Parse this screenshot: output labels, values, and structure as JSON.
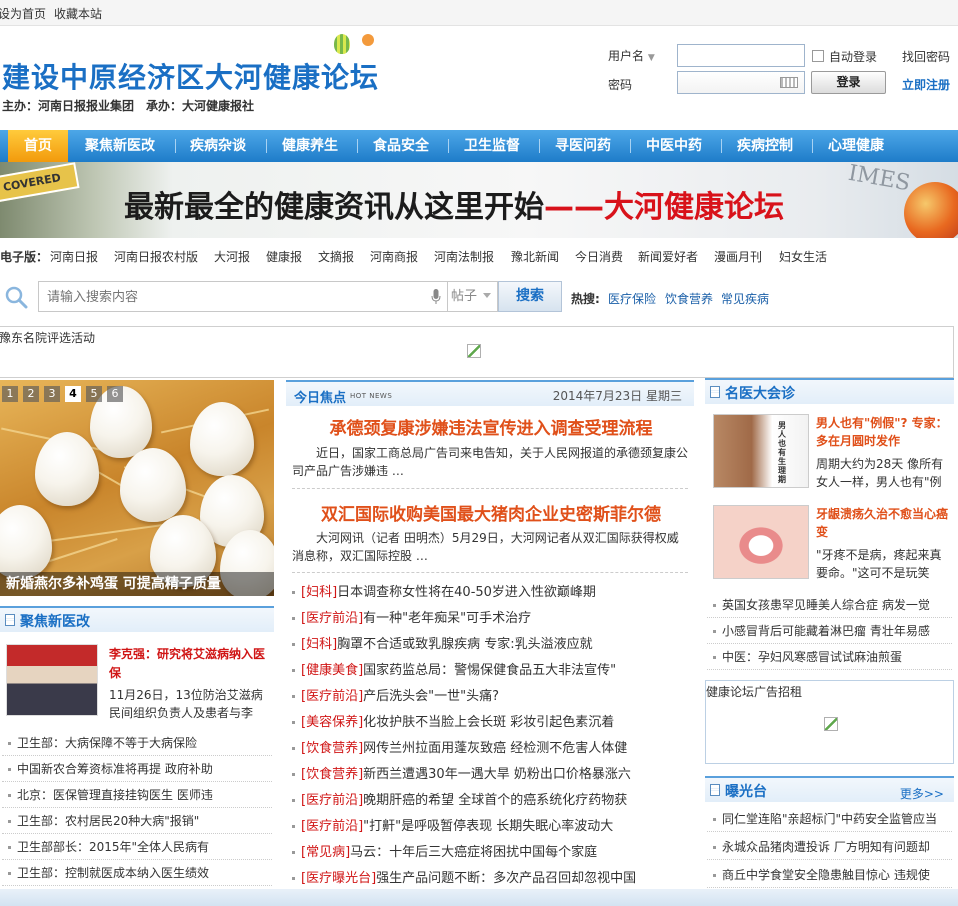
{
  "topbar": {
    "set_home": "设为首页",
    "bookmark": "收藏本站"
  },
  "header": {
    "site_title": "建设中原经济区大河健康论坛",
    "sponsor": "主办：河南日报报业集团　承办：大河健康报社"
  },
  "login": {
    "username_label": "用户名",
    "password_label": "密码",
    "auto_login": "自动登录",
    "forgot": "找回密码",
    "login_button": "登录",
    "register": "立即注册"
  },
  "nav": {
    "items": [
      "首页",
      "聚焦新医改",
      "疾病杂谈",
      "健康养生",
      "食品安全",
      "卫生监督",
      "寻医问药",
      "中医中药",
      "疾病控制",
      "心理健康"
    ]
  },
  "banner": {
    "text_black": "最新最全的健康资讯从这里开始",
    "text_red": "——大河健康论坛",
    "sign": "COVERED",
    "times": "IMES"
  },
  "editions": {
    "label": "电子版：",
    "items": [
      "河南日报",
      "河南日报农村版",
      "大河报",
      "健康报",
      "文摘报",
      "河南商报",
      "河南法制报",
      "豫北新闻",
      "今日消费",
      "新闻爱好者",
      "漫画月刊",
      "妇女生活"
    ]
  },
  "search": {
    "placeholder": "请输入搜索内容",
    "type": "帖子",
    "button": "搜索",
    "hot_label": "热搜:",
    "hot_items": [
      "医疗保险",
      "饮食营养",
      "常见疾病"
    ]
  },
  "ad1": {
    "text": "豫东名院评选活动"
  },
  "slideshow": {
    "numbers": [
      "1",
      "2",
      "3",
      "4",
      "5",
      "6"
    ],
    "active": 4,
    "caption": "新婚燕尔多补鸡蛋 可提高精子质量"
  },
  "left_panel": {
    "title": "聚焦新医改",
    "feature_title": "李克强：研究将艾滋病纳入医保",
    "feature_desc": "11月26日，13位防治艾滋病民间组织负责人及患者与李",
    "items": [
      "卫生部：大病保障不等于大病保险",
      "中国新农合筹资标准将再提 政府补助",
      "北京：医保管理直接挂钩医生 医师违",
      "卫生部：农村居民20种大病\"报销\"",
      "卫生部部长：2015年\"全体人民病有",
      "卫生部：控制就医成本纳入医生绩效"
    ]
  },
  "middle": {
    "focus_label": "今日焦点",
    "hot_news": "HOT NEWS",
    "date": "2014年7月23日 星期三",
    "headline1": "承德颈复康涉嫌违法宣传进入调查受理流程",
    "summary1": "近日，国家工商总局广告司来电告知，关于人民网报道的承德颈复康公司产品广告涉嫌违 …",
    "headline2": "双汇国际收购美国最大猪肉企业史密斯菲尔德",
    "summary2": "大河网讯（记者 田明杰）5月29日，大河网记者从双汇国际获得权威消息称，双汇国际控股 …",
    "news": [
      {
        "cat": "[妇科]",
        "title": "日本调查称女性将在40-50岁进入性欲巅峰期"
      },
      {
        "cat": "[医疗前沿]",
        "title": "有一种\"老年痴呆\"可手术治疗"
      },
      {
        "cat": "[妇科]",
        "title": "胸罩不合适或致乳腺疾病 专家:乳头溢液应就"
      },
      {
        "cat": "[健康美食]",
        "title": "国家药监总局：警惕保健食品五大非法宣传\""
      },
      {
        "cat": "[医疗前沿]",
        "title": "产后洗头会\"一世\"头痛?"
      },
      {
        "cat": "[美容保养]",
        "title": "化妆护肤不当脸上会长斑 彩妆引起色素沉着"
      },
      {
        "cat": "[饮食营养]",
        "title": "网传兰州拉面用蓬灰致癌 经检测不危害人体健"
      },
      {
        "cat": "[饮食营养]",
        "title": "新西兰遭遇30年一遇大旱 奶粉出口价格暴涨六"
      },
      {
        "cat": "[医疗前沿]",
        "title": "晚期肝癌的希望 全球首个的癌系统化疗药物获"
      },
      {
        "cat": "[医疗前沿]",
        "title": "\"打鼾\"是呼吸暂停表现 长期失眠心率波动大"
      },
      {
        "cat": "[常见病]",
        "title": "马云：十年后三大癌症将困扰中国每个家庭"
      },
      {
        "cat": "[医疗曝光台]",
        "title": "强生产品问题不断：多次产品召回却忽视中国"
      }
    ]
  },
  "right": {
    "doctor_title": "名医大会诊",
    "doc1_title": "男人也有\"例假\"? 专家：多在月圆时发作",
    "doc1_desc": "周期大约为28天 像所有女人一样，男人也有\"例",
    "doc1_img_text": "男人也有生理期",
    "doc2_title": "牙龈溃疡久治不愈当心癌变",
    "doc2_desc": "\"牙疼不是病，疼起来真要命。\"这可不是玩笑",
    "items": [
      "英国女孩患罕见睡美人综合症 病发一觉",
      "小感冒背后可能藏着淋巴瘤 青壮年易感",
      "中医：孕妇风寒感冒试试麻油煎蛋"
    ],
    "ad_text": "健康论坛广告招租",
    "exposure_title": "曝光台",
    "more": "更多>>",
    "exposure_items": [
      "同仁堂连陷\"亲超标门\"中药安全监管应当",
      "永城众品猪肉遭投诉 厂方明知有问题却",
      "商丘中学食堂安全隐患触目惊心 违规使"
    ]
  }
}
